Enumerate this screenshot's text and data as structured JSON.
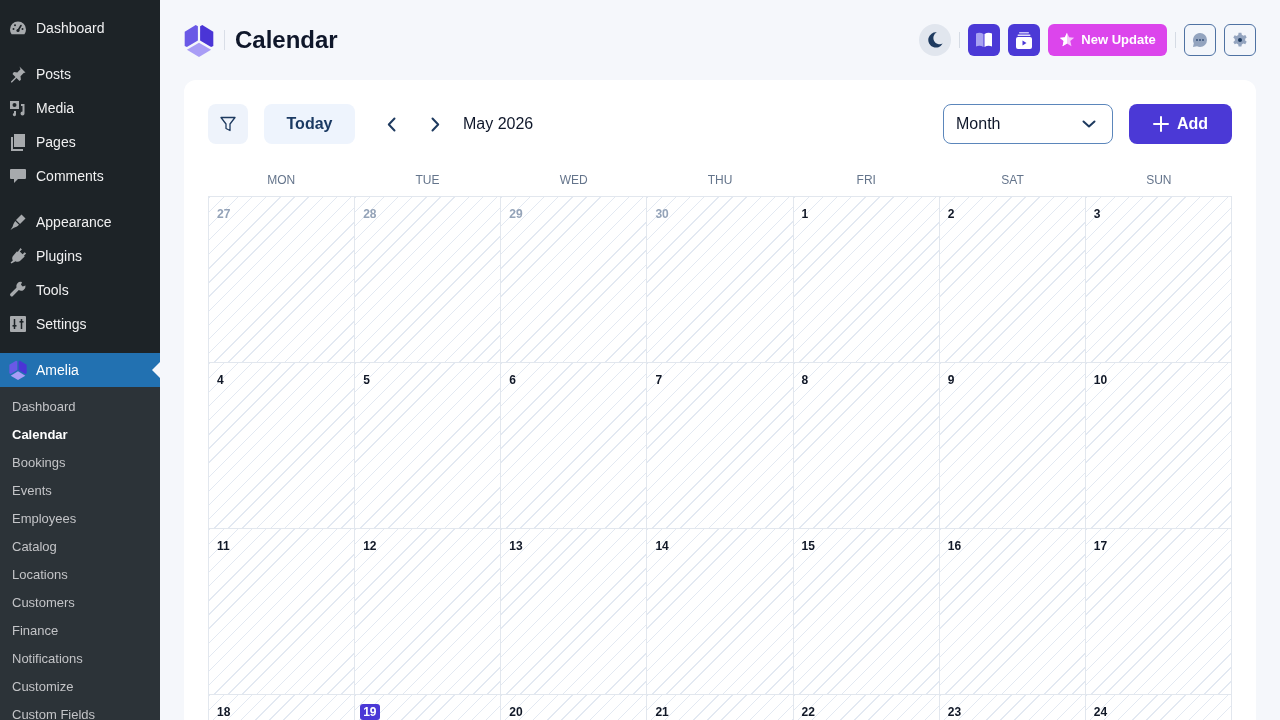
{
  "sidebar": {
    "menu_groups": [
      [
        {
          "label": "Dashboard",
          "selected": false
        }
      ],
      [
        {
          "label": "Posts",
          "selected": false
        },
        {
          "label": "Media",
          "selected": false
        },
        {
          "label": "Pages",
          "selected": false
        },
        {
          "label": "Comments",
          "selected": false
        }
      ],
      [
        {
          "label": "Appearance",
          "selected": false
        },
        {
          "label": "Plugins",
          "selected": false
        },
        {
          "label": "Tools",
          "selected": false
        },
        {
          "label": "Settings",
          "selected": false
        }
      ],
      [
        {
          "label": "Amelia",
          "selected": true
        }
      ]
    ],
    "submenu": [
      {
        "label": "Dashboard",
        "selected": false
      },
      {
        "label": "Calendar",
        "selected": true
      },
      {
        "label": "Bookings",
        "selected": false
      },
      {
        "label": "Events",
        "selected": false
      },
      {
        "label": "Employees",
        "selected": false
      },
      {
        "label": "Catalog",
        "selected": false
      },
      {
        "label": "Locations",
        "selected": false
      },
      {
        "label": "Customers",
        "selected": false
      },
      {
        "label": "Finance",
        "selected": false
      },
      {
        "label": "Notifications",
        "selected": false
      },
      {
        "label": "Customize",
        "selected": false
      },
      {
        "label": "Custom Fields",
        "selected": false
      }
    ]
  },
  "header": {
    "title": "Calendar",
    "update_button": "New Update"
  },
  "calendar": {
    "today_button": "Today",
    "period": "May 2026",
    "view_select": "Month",
    "add_button": "Add",
    "weekdays": [
      "MON",
      "TUE",
      "WED",
      "THU",
      "FRI",
      "SAT",
      "SUN"
    ],
    "weeks": [
      [
        {
          "date": "27",
          "in_month": false,
          "today": false
        },
        {
          "date": "28",
          "in_month": false,
          "today": false
        },
        {
          "date": "29",
          "in_month": false,
          "today": false
        },
        {
          "date": "30",
          "in_month": false,
          "today": false
        },
        {
          "date": "1",
          "in_month": true,
          "today": false
        },
        {
          "date": "2",
          "in_month": true,
          "today": false
        },
        {
          "date": "3",
          "in_month": true,
          "today": false
        }
      ],
      [
        {
          "date": "4",
          "in_month": true,
          "today": false
        },
        {
          "date": "5",
          "in_month": true,
          "today": false
        },
        {
          "date": "6",
          "in_month": true,
          "today": false
        },
        {
          "date": "7",
          "in_month": true,
          "today": false
        },
        {
          "date": "8",
          "in_month": true,
          "today": false
        },
        {
          "date": "9",
          "in_month": true,
          "today": false
        },
        {
          "date": "10",
          "in_month": true,
          "today": false
        }
      ],
      [
        {
          "date": "11",
          "in_month": true,
          "today": false
        },
        {
          "date": "12",
          "in_month": true,
          "today": false
        },
        {
          "date": "13",
          "in_month": true,
          "today": false
        },
        {
          "date": "14",
          "in_month": true,
          "today": false
        },
        {
          "date": "15",
          "in_month": true,
          "today": false
        },
        {
          "date": "16",
          "in_month": true,
          "today": false
        },
        {
          "date": "17",
          "in_month": true,
          "today": false
        }
      ],
      [
        {
          "date": "18",
          "in_month": true,
          "today": false
        },
        {
          "date": "19",
          "in_month": true,
          "today": true
        },
        {
          "date": "20",
          "in_month": true,
          "today": false
        },
        {
          "date": "21",
          "in_month": true,
          "today": false
        },
        {
          "date": "22",
          "in_month": true,
          "today": false
        },
        {
          "date": "23",
          "in_month": true,
          "today": false
        },
        {
          "date": "24",
          "in_month": true,
          "today": false
        }
      ]
    ]
  }
}
